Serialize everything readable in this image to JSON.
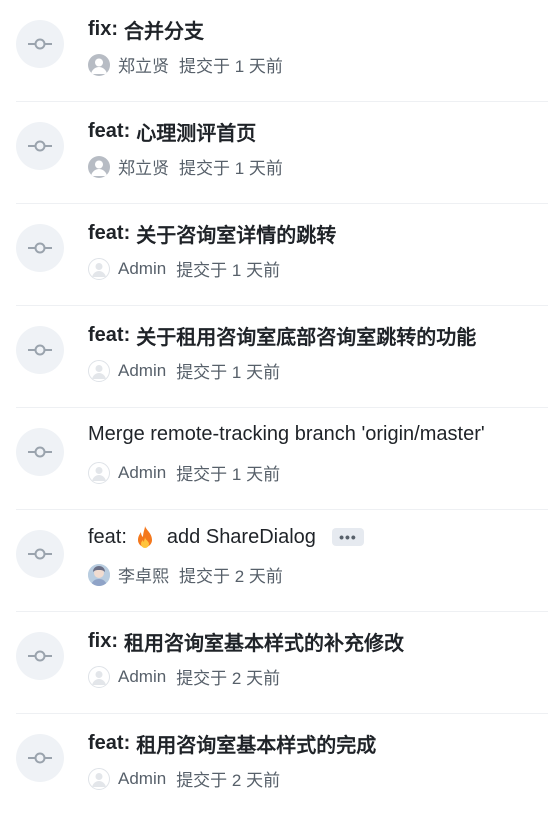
{
  "commits": [
    {
      "prefix": "fix:",
      "message": "合并分支",
      "author": "郑立贤",
      "time": "提交于 1 天前",
      "avatar": "gray"
    },
    {
      "prefix": "feat:",
      "message": "心理测评首页",
      "author": "郑立贤",
      "time": "提交于 1 天前",
      "avatar": "gray"
    },
    {
      "prefix": "feat:",
      "message": "关于咨询室详情的跳转",
      "author": "Admin",
      "time": "提交于 1 天前",
      "avatar": "light"
    },
    {
      "prefix": "feat:",
      "message": "关于租用咨询室底部咨询室跳转的功能",
      "author": "Admin",
      "time": "提交于 1 天前",
      "avatar": "light"
    },
    {
      "prefix": "",
      "message": "Merge remote-tracking branch 'origin/master'",
      "author": "Admin",
      "time": "提交于 1 天前",
      "avatar": "light",
      "regular": true
    },
    {
      "prefix": "feat:",
      "message": "add ShareDialog",
      "author": "李卓熙",
      "time": "提交于 2 天前",
      "avatar": "photo",
      "regular": true,
      "emoji": "fire-icon",
      "more_label": "•••"
    },
    {
      "prefix": "fix:",
      "message": "租用咨询室基本样式的补充修改",
      "author": "Admin",
      "time": "提交于 2 天前",
      "avatar": "light"
    },
    {
      "prefix": "feat:",
      "message": "租用咨询室基本样式的完成",
      "author": "Admin",
      "time": "提交于 2 天前",
      "avatar": "light"
    }
  ],
  "colors": {
    "icon_bg": "#eff2f6",
    "icon_stroke": "#9aa3ad",
    "meta_text": "#57606a",
    "title_text": "#1f2328"
  }
}
